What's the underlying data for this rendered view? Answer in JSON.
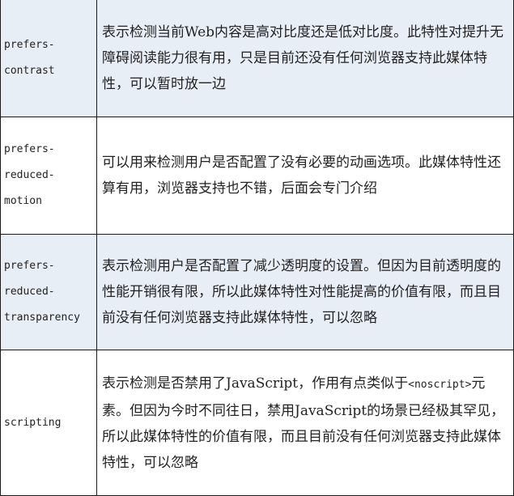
{
  "rows": [
    {
      "key": "prefers-\ncontrast",
      "desc": "表示检测当前Web内容是高对比度还是低对比度。此特性对提升无障碍阅读能力很有用，只是目前还没有任何浏览器支持此媒体特性，可以暂时放一边"
    },
    {
      "key": "prefers-\nreduced-\nmotion",
      "desc": "可以用来检测用户是否配置了没有必要的动画选项。此媒体特性还算有用，浏览器支持也不错，后面会专门介绍"
    },
    {
      "key": "prefers-\nreduced-\ntransparency",
      "desc": "表示检测用户是否配置了减少透明度的设置。但因为目前透明度的性能开销很有限，所以此媒体特性对性能提高的价值有限，而且目前没有任何浏览器支持此媒体特性，可以忽略"
    },
    {
      "key": "scripting",
      "desc_a": "表示检测是否禁用了JavaScript，作用有点类似于",
      "desc_code": "<noscript>",
      "desc_b": "元素。但因为今时不同往日，禁用JavaScript的场景已经极其罕见，所以此媒体特性的价值有限，而且目前没有任何浏览器支持此媒体特性，可以忽略"
    }
  ]
}
